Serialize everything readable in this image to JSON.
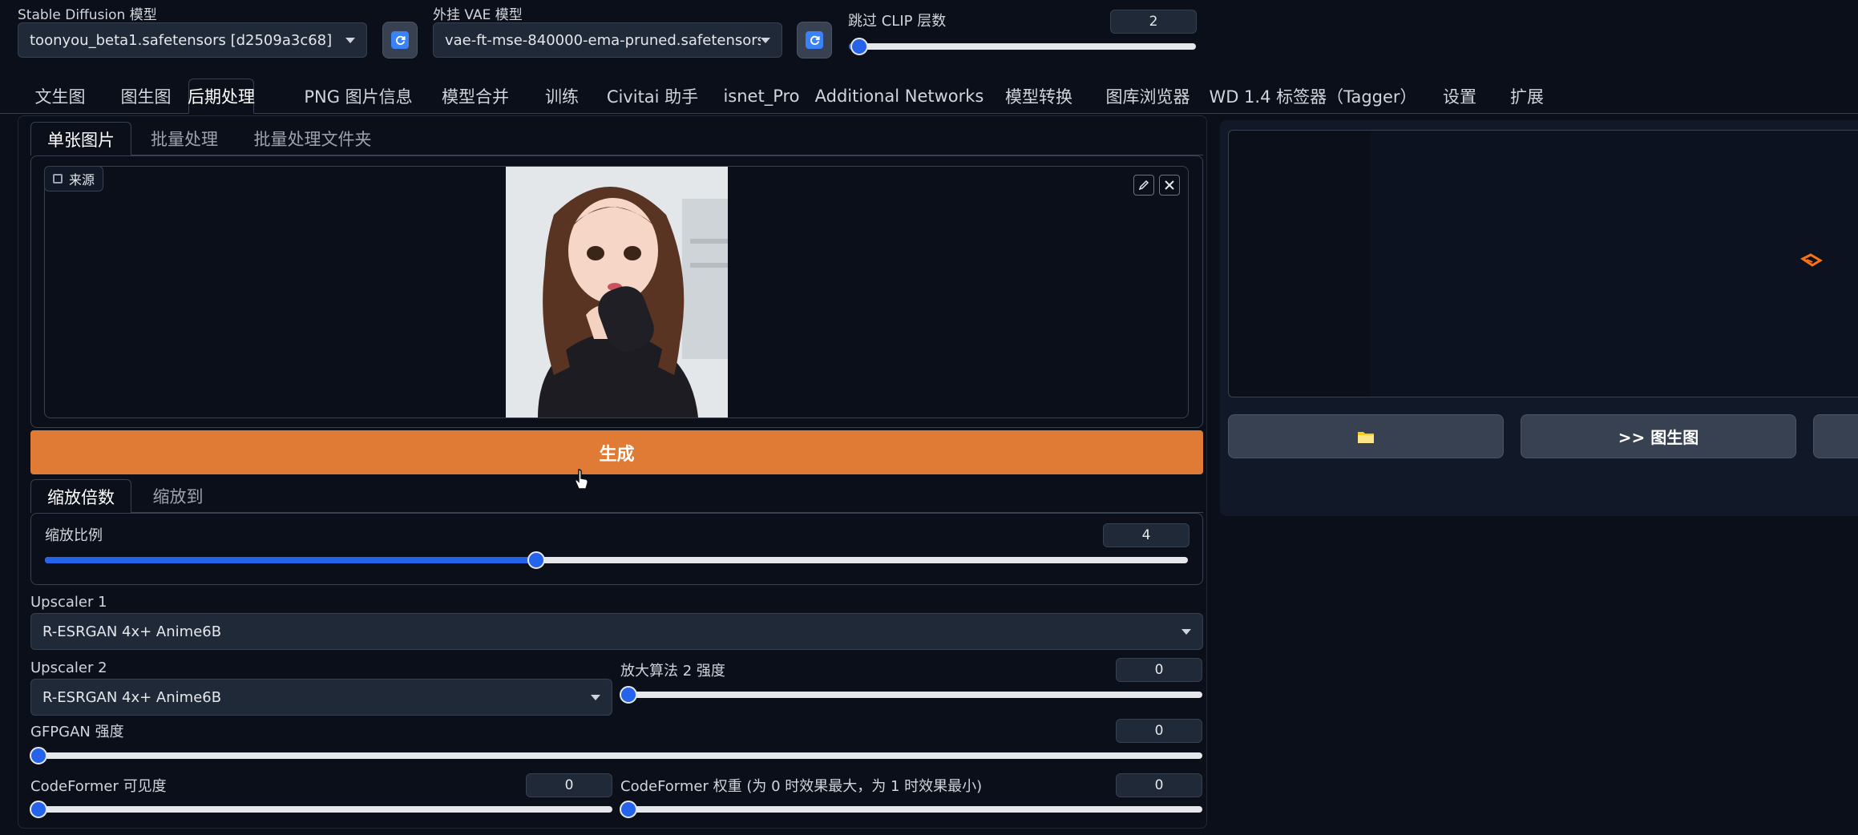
{
  "header": {
    "sd_model_label": "Stable Diffusion 模型",
    "sd_model_value": "toonyou_beta1.safetensors [d2509a3c68]",
    "vae_label": "外挂 VAE 模型",
    "vae_value": "vae-ft-mse-840000-ema-pruned.safetensors",
    "clip_label": "跳过 CLIP 层数",
    "clip_value": "2",
    "clip_fraction": 0.03
  },
  "main_tabs": [
    "文生图",
    "图生图",
    "后期处理",
    "PNG 图片信息",
    "模型合并",
    "训练",
    "Civitai 助手",
    "isnet_Pro",
    "Additional Networks",
    "模型转换",
    "图库浏览器",
    "WD 1.4 标签器（Tagger）",
    "设置",
    "扩展"
  ],
  "sub_tabs": [
    "单张图片",
    "批量处理",
    "批量处理文件夹"
  ],
  "source": {
    "label": "来源"
  },
  "generate_label": "生成",
  "scale_tabs": [
    "缩放倍数",
    "缩放到"
  ],
  "resize": {
    "label": "缩放比例",
    "value": "4",
    "fraction": 0.43
  },
  "upscaler1": {
    "label": "Upscaler 1",
    "value": "R-ESRGAN 4x+ Anime6B"
  },
  "upscaler2": {
    "label": "Upscaler 2",
    "value": "R-ESRGAN 4x+ Anime6B",
    "strength_label": "放大算法 2 强度",
    "strength_value": "0"
  },
  "gfpgan": {
    "label": "GFPGAN 强度",
    "value": "0"
  },
  "codeformer": {
    "visibility_label": "CodeFormer 可见度",
    "visibility_value": "0",
    "weight_label": "CodeFormer 权重 (为 0 时效果最大，为 1 时效果最小)",
    "weight_value": "0"
  },
  "output": {
    "send_img2img_label": ">> 图生图"
  },
  "colors": {
    "accent": "#e07b35",
    "slider": "#2563eb",
    "background": "#0b0f19"
  }
}
